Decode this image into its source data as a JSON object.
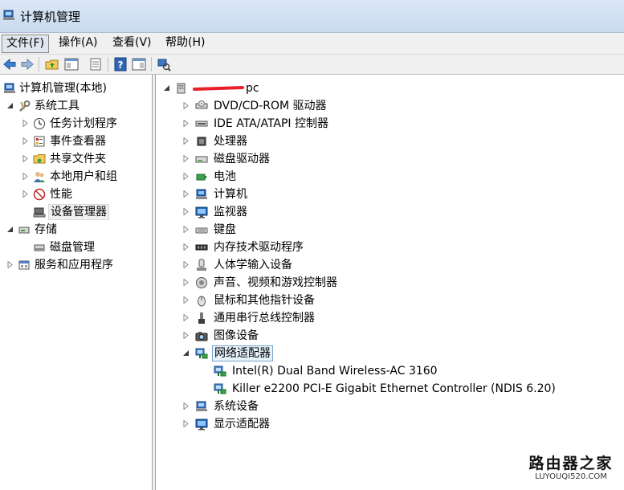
{
  "window": {
    "title": "计算机管理"
  },
  "menu": [
    {
      "label": "文件(F)"
    },
    {
      "label": "操作(A)"
    },
    {
      "label": "查看(V)"
    },
    {
      "label": "帮助(H)"
    }
  ],
  "left_tree": {
    "root": "计算机管理(本地)",
    "system_tools": "系统工具",
    "task_scheduler": "任务计划程序",
    "event_viewer": "事件查看器",
    "shared_folders": "共享文件夹",
    "local_users": "本地用户和组",
    "performance": "性能",
    "device_manager": "设备管理器",
    "storage": "存储",
    "disk_management": "磁盘管理",
    "services_apps": "服务和应用程序"
  },
  "device_tree": {
    "computer_name": "pc",
    "categories": [
      "DVD/CD-ROM 驱动器",
      "IDE ATA/ATAPI 控制器",
      "处理器",
      "磁盘驱动器",
      "电池",
      "计算机",
      "监视器",
      "键盘",
      "内存技术驱动程序",
      "人体学输入设备",
      "声音、视频和游戏控制器",
      "鼠标和其他指针设备",
      "通用串行总线控制器",
      "图像设备",
      "网络适配器"
    ],
    "network_adapters": [
      "Intel(R) Dual Band Wireless-AC 3160",
      "Killer e2200 PCI-E Gigabit Ethernet Controller (NDIS 6.20)"
    ],
    "after": [
      "系统设备",
      "显示适配器"
    ]
  },
  "watermark": {
    "title": "路由器之家",
    "url": "LUYOUQI520.COM"
  }
}
